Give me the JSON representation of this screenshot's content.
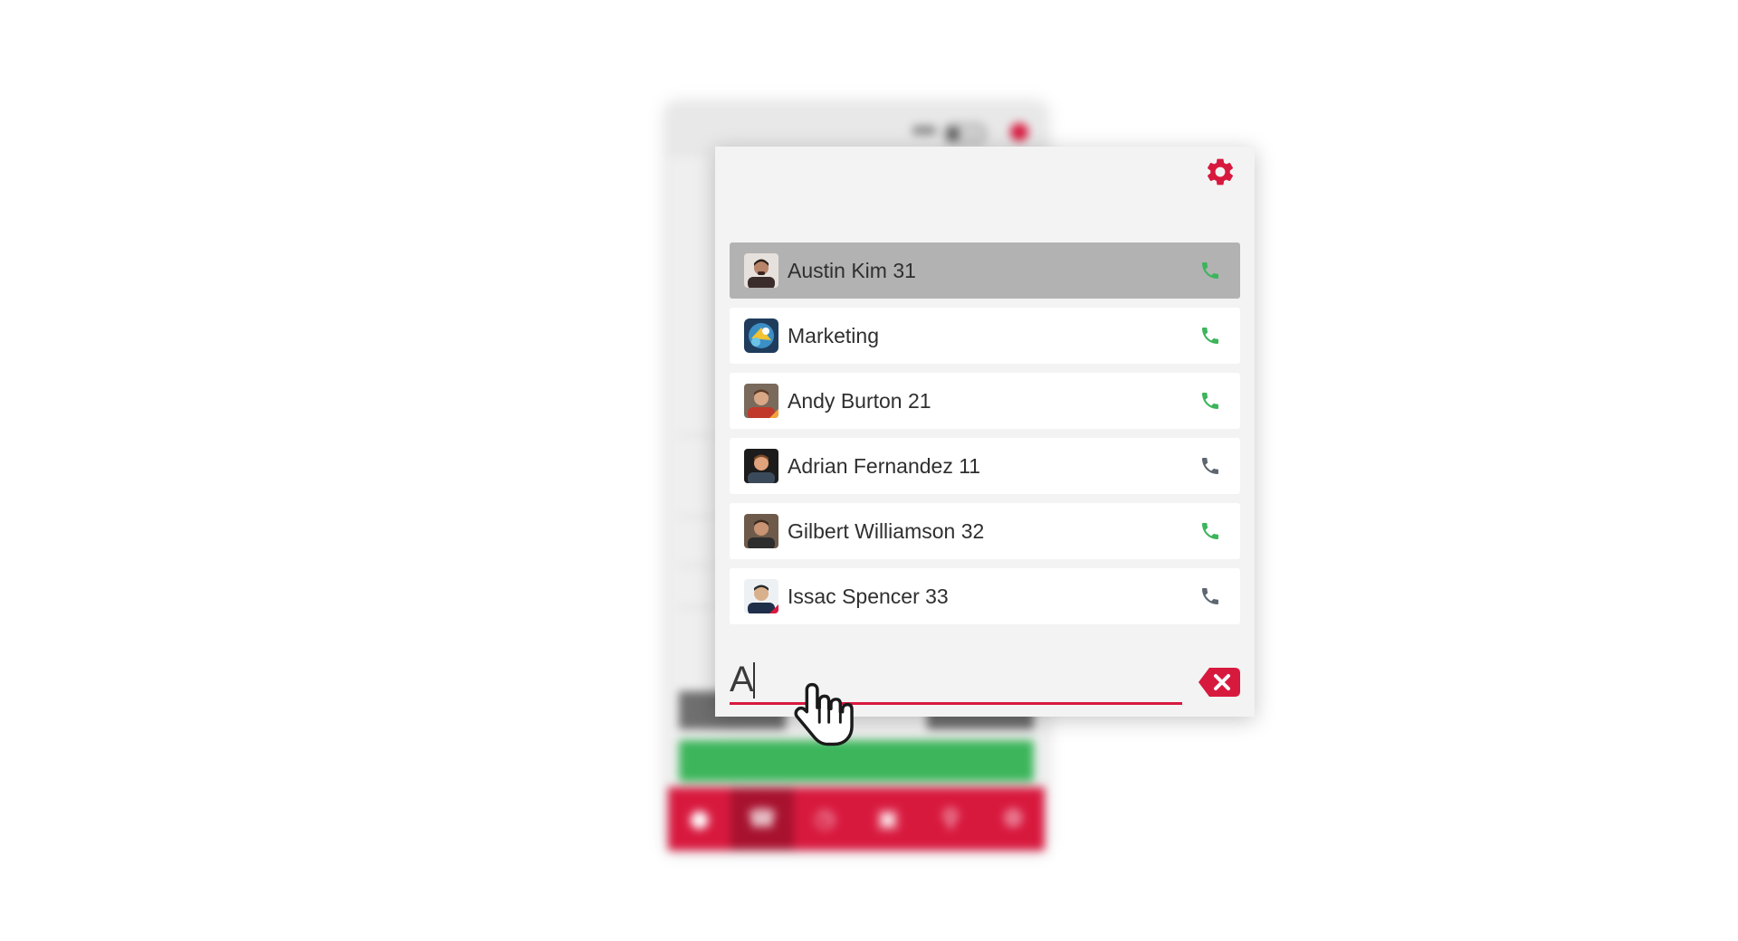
{
  "search": {
    "value": "A",
    "placeholder": ""
  },
  "settings_icon": "gear-icon",
  "clear_icon": "backspace-icon",
  "contacts": [
    {
      "name": "Austin Kim 31",
      "selected": true,
      "status": "available"
    },
    {
      "name": "Marketing",
      "selected": false,
      "status": "available"
    },
    {
      "name": "Andy Burton 21",
      "selected": false,
      "status": "available"
    },
    {
      "name": "Adrian Fernandez 11",
      "selected": false,
      "status": "offline"
    },
    {
      "name": "Gilbert Williamson 32",
      "selected": false,
      "status": "available"
    },
    {
      "name": "Issac Spencer 33",
      "selected": false,
      "status": "offline"
    }
  ],
  "colors": {
    "accent": "#d8193e",
    "available": "#3cb55b",
    "offline": "#5e6770",
    "selected_row": "#b2b2b2",
    "panel_bg": "#f3f3f3"
  },
  "background_nav": {
    "items": [
      "contacts-icon",
      "phone-icon",
      "history-icon",
      "addressbook-icon",
      "search-icon",
      "gear-icon"
    ],
    "active": "phone-icon"
  }
}
